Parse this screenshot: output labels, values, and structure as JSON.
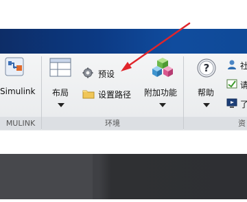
{
  "ribbon": {
    "simulink_label": "Simulink",
    "simulink_group": "MULINK",
    "layout_label": "布局",
    "preferences_label": "预设",
    "set_path_label": "设置路径",
    "addons_label": "附加功能",
    "environment_group": "环境",
    "help_label": "帮助",
    "resources_group_partial": "资",
    "side_partial_1": "社",
    "side_partial_2": "请",
    "side_partial_3": "了"
  },
  "colors": {
    "title_band": "#0c3a84",
    "annotation_arrow": "#e0252b"
  }
}
